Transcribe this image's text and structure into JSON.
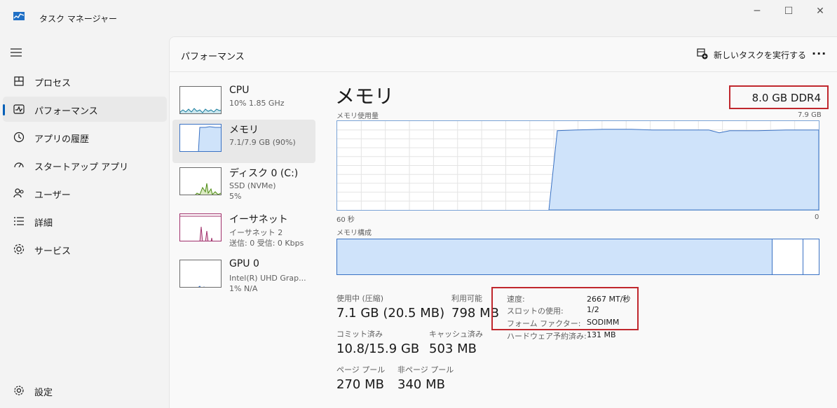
{
  "window": {
    "title": "タスク マネージャー",
    "controls": [
      "─",
      "☐",
      "✕"
    ]
  },
  "nav": {
    "items": [
      {
        "label": "プロセス",
        "icon": "processes-icon"
      },
      {
        "label": "パフォーマンス",
        "icon": "performance-icon",
        "active": true
      },
      {
        "label": "アプリの履歴",
        "icon": "history-icon"
      },
      {
        "label": "スタートアップ アプリ",
        "icon": "startup-icon"
      },
      {
        "label": "ユーザー",
        "icon": "users-icon"
      },
      {
        "label": "詳細",
        "icon": "details-icon"
      },
      {
        "label": "サービス",
        "icon": "services-icon"
      }
    ],
    "settings_label": "設定"
  },
  "header": {
    "title": "パフォーマンス",
    "new_task_label": "新しいタスクを実行する",
    "more_label": "···"
  },
  "devices": [
    {
      "name": "CPU",
      "sub1": "10%  1.85 GHz",
      "sub2": ""
    },
    {
      "name": "メモリ",
      "sub1": "7.1/7.9 GB (90%)",
      "sub2": ""
    },
    {
      "name": "ディスク 0 (C:)",
      "sub1": "SSD (NVMe)",
      "sub2": "5%"
    },
    {
      "name": "イーサネット",
      "sub1": "イーサネット 2",
      "sub2": "送信: 0  受信: 0 Kbps"
    },
    {
      "name": "GPU 0",
      "sub1": "Intel(R) UHD Grap...",
      "sub2": "1%  N/A"
    }
  ],
  "memory": {
    "title": "メモリ",
    "type": "8.0 GB DDR4",
    "usage_label": "メモリ使用量",
    "usage_max": "7.9 GB",
    "time_left": "60 秒",
    "time_right": "0",
    "composition_label": "メモリ構成",
    "composition": {
      "in_use_fraction": 0.904,
      "modified_fraction": 0.062
    },
    "usage_history_fraction": {
      "before_jump": 0.0,
      "after_jump": 0.9
    },
    "stats": {
      "in_use_label": "使用中 (圧縮)",
      "in_use_value": "7.1 GB (20.5 MB)",
      "available_label": "利用可能",
      "available_value": "798 MB",
      "committed_label": "コミット済み",
      "committed_value": "10.8/15.9 GB",
      "cached_label": "キャッシュ済み",
      "cached_value": "503 MB",
      "paged_label": "ページ プール",
      "paged_value": "270 MB",
      "nonpaged_label": "非ページ プール",
      "nonpaged_value": "340 MB"
    },
    "details": {
      "speed_label": "速度:",
      "speed_value": "2667 MT/秒",
      "slots_label": "スロットの使用:",
      "slots_value": "1/2",
      "form_label": "フォーム ファクター:",
      "form_value": "SODIMM",
      "reserved_label": "ハードウェア予約済み:",
      "reserved_value": "131 MB"
    }
  },
  "colors": {
    "memory_fill": "#cfe3fa",
    "memory_line": "#3a72c4",
    "highlight": "#c0272d",
    "accent": "#005fb8"
  }
}
